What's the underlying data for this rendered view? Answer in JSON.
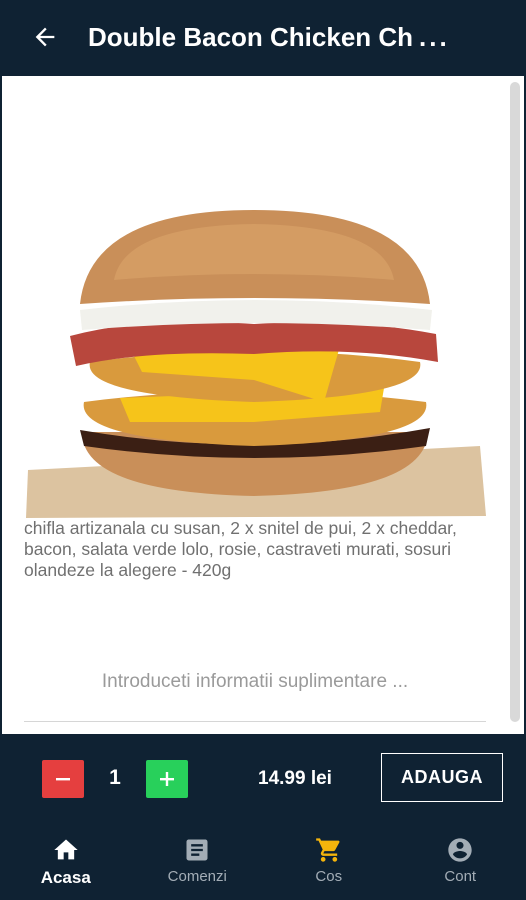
{
  "header": {
    "title": "Double Bacon Chicken Ch",
    "ellipsis": "..."
  },
  "product": {
    "description": "chifla artizanala cu susan, 2 x snitel de pui, 2 x cheddar, bacon, salata verde lolo, rosie, castraveti murati, sosuri olandeze la alegere - 420g",
    "notes_placeholder": "Introduceti informatii suplimentare ..."
  },
  "order": {
    "quantity": "1",
    "price": "14.99 lei",
    "add_label": "ADAUGA"
  },
  "nav": {
    "items": [
      {
        "label": "Acasa",
        "icon": "home-icon"
      },
      {
        "label": "Comenzi",
        "icon": "orders-icon"
      },
      {
        "label": "Cos",
        "icon": "cart-icon"
      },
      {
        "label": "Cont",
        "icon": "account-icon"
      }
    ]
  },
  "colors": {
    "background": "#0f2233",
    "minus": "#e53f3f",
    "plus": "#28d05b",
    "cart_accent": "#f5b50c"
  }
}
